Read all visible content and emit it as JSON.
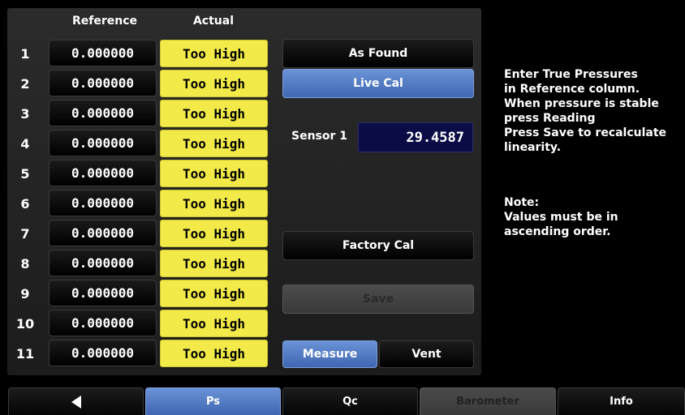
{
  "table": {
    "headers": {
      "reference": "Reference",
      "actual": "Actual"
    },
    "rows": [
      {
        "num": "1",
        "reference": "0.000000",
        "actual": "Too High"
      },
      {
        "num": "2",
        "reference": "0.000000",
        "actual": "Too High"
      },
      {
        "num": "3",
        "reference": "0.000000",
        "actual": "Too High"
      },
      {
        "num": "4",
        "reference": "0.000000",
        "actual": "Too High"
      },
      {
        "num": "5",
        "reference": "0.000000",
        "actual": "Too High"
      },
      {
        "num": "6",
        "reference": "0.000000",
        "actual": "Too High"
      },
      {
        "num": "7",
        "reference": "0.000000",
        "actual": "Too High"
      },
      {
        "num": "8",
        "reference": "0.000000",
        "actual": "Too High"
      },
      {
        "num": "9",
        "reference": "0.000000",
        "actual": "Too High"
      },
      {
        "num": "10",
        "reference": "0.000000",
        "actual": "Too High"
      },
      {
        "num": "11",
        "reference": "0.000000",
        "actual": "Too High"
      }
    ]
  },
  "buttons": {
    "as_found": "As Found",
    "live_cal": "Live Cal",
    "factory_cal": "Factory Cal",
    "save": "Save",
    "measure": "Measure",
    "vent": "Vent"
  },
  "sensor": {
    "label": "Sensor 1",
    "value": "29.4587"
  },
  "instructions": {
    "lines": [
      "Enter True Pressures",
      "in Reference column.",
      "When pressure is stable",
      "press Reading",
      "Press Save to recalculate",
      "linearity."
    ],
    "note_title": "Note:",
    "note_lines": [
      "Values must be in",
      "ascending order."
    ]
  },
  "tabs": {
    "back_icon": "left-triangle-arrow",
    "ps": "Ps",
    "qc": "Qc",
    "barometer": "Barometer",
    "info": "Info"
  },
  "colors": {
    "actual_cell": "#f2ea48",
    "active_blue": "#4f78c4",
    "sensor_bg": "#0b0c45"
  }
}
